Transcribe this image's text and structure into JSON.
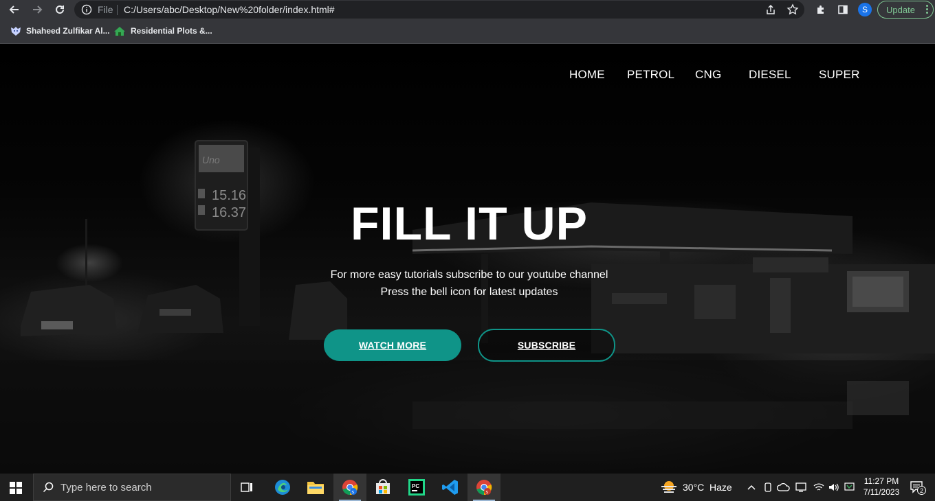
{
  "browser": {
    "omnibox": {
      "scheme_label": "File",
      "url": "C:/Users/abc/Desktop/New%20folder/index.html#"
    },
    "profile_initial": "S",
    "update_label": "Update",
    "bookmarks": [
      {
        "label": "Shaheed Zulfikar Al...",
        "icon": "wolf-logo-icon"
      },
      {
        "label": "Residential Plots &...",
        "icon": "house-logo-icon"
      }
    ]
  },
  "page": {
    "nav": [
      "HOME",
      "PETROL",
      "CNG",
      "DIESEL",
      "SUPER"
    ],
    "hero": {
      "title": "FILL IT UP",
      "line1": "For more easy tutorials subscribe to our youtube channel",
      "line2": "Press the bell icon for latest updates",
      "watch_label": "WATCH MORE",
      "subscribe_label": "SUBSCRIBE"
    },
    "scene_sign": {
      "brand": "Uno",
      "price1": "15.16",
      "price2": "16.37"
    },
    "colors": {
      "accent": "#0f9488",
      "background": "#000000"
    }
  },
  "taskbar": {
    "search_placeholder": "Type here to search",
    "apps": [
      "task-view-icon",
      "edge-icon",
      "file-explorer-icon",
      "chrome-icon",
      "microsoft-store-icon",
      "pycharm-icon",
      "vscode-icon",
      "chrome-profile-icon"
    ],
    "weather_temp": "30°C",
    "weather_text": "Haze",
    "time": "11:27 PM",
    "date": "7/11/2023",
    "notification_count": "2"
  }
}
